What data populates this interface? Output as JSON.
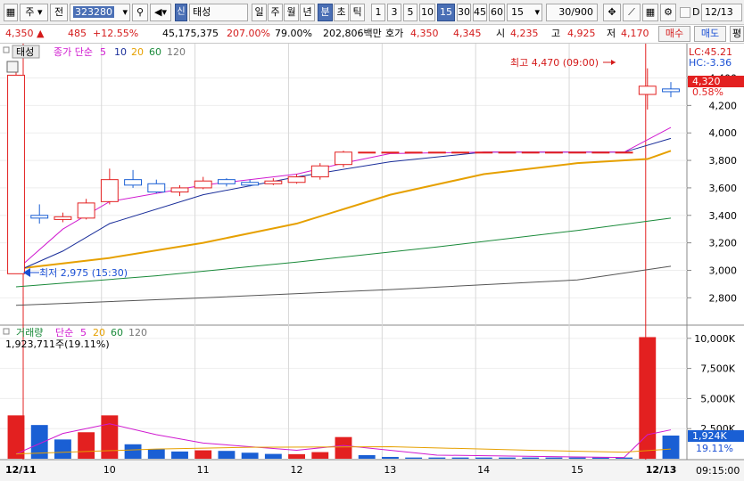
{
  "toolbar": {
    "market_label": "주",
    "period_label": "전",
    "code_value": "323280",
    "badge": "신",
    "stock_name": "태성",
    "period_tabs": [
      "일",
      "주",
      "월",
      "년",
      "분",
      "초",
      "틱"
    ],
    "minute_tabs": [
      "1",
      "3",
      "5",
      "10",
      "15",
      "30",
      "45",
      "60"
    ],
    "selected_minute": "15",
    "interval_value": "15",
    "count_value": "30/900",
    "d_label": "D",
    "date_value": "12/13"
  },
  "info": {
    "price": "4,350",
    "change": "485",
    "change_pct": "+12.55%",
    "volume": "45,175,375",
    "vol_ratio": "207.00%",
    "turnover": "79.00%",
    "amount": "202,806백만",
    "bid_label": "호가",
    "bid1": "4,350",
    "bid2": "4,345",
    "open_label": "시",
    "open": "4,235",
    "high_label": "고",
    "high": "4,925",
    "low_label": "저",
    "low": "4,170",
    "buy_btn": "매수",
    "sell_btn": "매도",
    "extra_btn": "평"
  },
  "price_panel": {
    "title": "태성",
    "ma_label": "종가 단순",
    "ma_periods": [
      "5",
      "10",
      "20",
      "60",
      "120"
    ],
    "lc": "LC:45.21",
    "hc": "HC:-3.36",
    "high_marker": "최고 4,470 (09:00)",
    "low_marker": "최저 2,975 (15:30)",
    "current_price": "4,320",
    "current_pct": "0.58%",
    "y_ticks": [
      "4,400",
      "4,200",
      "4,000",
      "3,800",
      "3,600",
      "3,400",
      "3,200",
      "3,000",
      "2,800"
    ]
  },
  "volume_panel": {
    "title": "거래량",
    "ma_label": "단순",
    "ma_periods": [
      "5",
      "20",
      "60",
      "120"
    ],
    "summary": "1,923,711주(19.11%)",
    "y_ticks": [
      "10,000K",
      "7,500K",
      "5,000K",
      "2,500K"
    ],
    "current": "1,924K",
    "current_pct": "19.11%"
  },
  "x_axis": {
    "labels": [
      "12/11",
      "10",
      "11",
      "12",
      "13",
      "14",
      "15",
      "12/13"
    ],
    "time": "09:15:00"
  },
  "colors": {
    "up": "#e32020",
    "down": "#1a5fd4",
    "ma5": "#d01ad0",
    "ma10": "#1a2e9a",
    "ma20": "#e6a000",
    "ma60": "#1a8a3a",
    "ma120": "#555555"
  },
  "chart_data": {
    "type": "candlestick",
    "candles": [
      {
        "o": 2975,
        "h": 4450,
        "l": 2975,
        "c": 4420
      },
      {
        "o": 3400,
        "h": 3480,
        "l": 3340,
        "c": 3380
      },
      {
        "o": 3370,
        "h": 3420,
        "l": 3350,
        "c": 3390
      },
      {
        "o": 3380,
        "h": 3520,
        "l": 3370,
        "c": 3490
      },
      {
        "o": 3500,
        "h": 3740,
        "l": 3480,
        "c": 3660
      },
      {
        "o": 3660,
        "h": 3730,
        "l": 3600,
        "c": 3620
      },
      {
        "o": 3630,
        "h": 3660,
        "l": 3560,
        "c": 3570
      },
      {
        "o": 3570,
        "h": 3620,
        "l": 3540,
        "c": 3600
      },
      {
        "o": 3600,
        "h": 3680,
        "l": 3590,
        "c": 3650
      },
      {
        "o": 3660,
        "h": 3670,
        "l": 3610,
        "c": 3630
      },
      {
        "o": 3640,
        "h": 3660,
        "l": 3610,
        "c": 3620
      },
      {
        "o": 3630,
        "h": 3670,
        "l": 3620,
        "c": 3650
      },
      {
        "o": 3640,
        "h": 3700,
        "l": 3630,
        "c": 3680
      },
      {
        "o": 3680,
        "h": 3780,
        "l": 3660,
        "c": 3760
      },
      {
        "o": 3770,
        "h": 3870,
        "l": 3750,
        "c": 3860
      },
      {
        "o": 3860,
        "h": 3860,
        "l": 3860,
        "c": 3860
      },
      {
        "o": 3860,
        "h": 3860,
        "l": 3860,
        "c": 3860
      },
      {
        "o": 3860,
        "h": 3860,
        "l": 3860,
        "c": 3860
      },
      {
        "o": 3860,
        "h": 3860,
        "l": 3860,
        "c": 3860
      },
      {
        "o": 3860,
        "h": 3860,
        "l": 3860,
        "c": 3860
      },
      {
        "o": 3860,
        "h": 3860,
        "l": 3860,
        "c": 3860
      },
      {
        "o": 3860,
        "h": 3860,
        "l": 3860,
        "c": 3860
      },
      {
        "o": 3860,
        "h": 3860,
        "l": 3860,
        "c": 3860
      },
      {
        "o": 3860,
        "h": 3860,
        "l": 3860,
        "c": 3860
      },
      {
        "o": 3860,
        "h": 3860,
        "l": 3860,
        "c": 3860
      },
      {
        "o": 3860,
        "h": 3860,
        "l": 3860,
        "c": 3860
      },
      {
        "o": 3860,
        "h": 3860,
        "l": 3860,
        "c": 3860
      },
      {
        "o": 4280,
        "h": 4470,
        "l": 4170,
        "c": 4340
      },
      {
        "o": 4320,
        "h": 4370,
        "l": 4260,
        "c": 4300
      }
    ],
    "volumes": [
      3600,
      2800,
      1600,
      2200,
      3600,
      1200,
      800,
      600,
      700,
      650,
      500,
      400,
      380,
      550,
      1800,
      300,
      150,
      100,
      100,
      100,
      100,
      100,
      100,
      100,
      100,
      100,
      100,
      10100,
      1924
    ],
    "volume_dir": [
      "up",
      "down",
      "down",
      "up",
      "up",
      "down",
      "down",
      "down",
      "up",
      "down",
      "down",
      "down",
      "up",
      "up",
      "up",
      "down",
      "down",
      "down",
      "down",
      "down",
      "down",
      "down",
      "down",
      "down",
      "down",
      "down",
      "down",
      "up",
      "down"
    ],
    "y_range": [
      2640,
      4520
    ],
    "vol_range": [
      0,
      10800
    ]
  }
}
